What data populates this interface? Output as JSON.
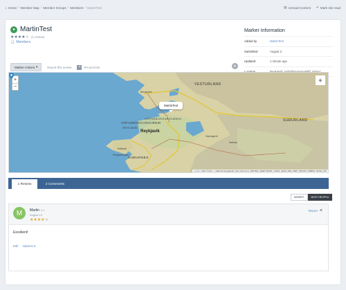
{
  "breadcrumb": {
    "items": [
      "Home",
      "Member Map",
      "Member Groups",
      "Members",
      "MartinTest"
    ]
  },
  "topnav": {
    "unread": "Unread Content",
    "mark_read": "Mark site read"
  },
  "marker": {
    "title": "MartinTest",
    "reviews_count": "(1 review)",
    "members_link": "Members",
    "rating": 4,
    "actions_btn": "Marker Actions",
    "report": "Report this review",
    "promote": "Re-promote"
  },
  "info": {
    "heading": "Marker Information",
    "rows": [
      {
        "key": "Added by",
        "value": "MartinTest"
      },
      {
        "key": "Submitted",
        "value": "August 2"
      },
      {
        "key": "Updated",
        "value": "1 minute ago"
      },
      {
        "key": "Location",
        "value": "Reykjavík, Höfuðborgarsvæðið, Island"
      },
      {
        "key": "Coordinates",
        "value": "N 64° 14' 39.756\"   W 21° 46' 4.535\""
      }
    ]
  },
  "map": {
    "zoom_in": "+",
    "zoom_out": "−",
    "popup": "MartinTest",
    "labels": {
      "vesturland": "VESTURLAND",
      "borgarnes": "Borgarnes",
      "sudurland": "SUÐURLAND",
      "hofud": "HÖFUÐBORGARSVÆÐIÐ",
      "capital": "HÖFUÐBORGARSVÆÐIN",
      "reykjavik_caps": "REYKJAVÍK",
      "reykjavik": "Reykjavík",
      "selfoss": "Selfoss",
      "keflavik": "Keflavík",
      "sudurnes": "SUÐURNES",
      "hveragerdi": "Hveragerði",
      "reykjanesbaer": "Reykjanesbær"
    },
    "attribution_link": "Leaflet",
    "attribution": " | Tiles © Esri — National Geographic, Esri, DeLorme, NAVTEQ, UNEP-WCMC, USGS, NASA, ESA, METI, NRCAN, GEBCO, NOAA, iPC"
  },
  "tabs": {
    "reviews": "1 Review",
    "comments": "2 Comments"
  },
  "sort": {
    "newest": "NEWEST",
    "helpful": "MOST HELPFUL"
  },
  "review": {
    "avatar_letter": "M",
    "author": "Martin",
    "rep": "● 4",
    "date": "August 13",
    "rating": 4,
    "report": "Report",
    "body": "Excellent!",
    "edit": "Edit",
    "options": "Options"
  },
  "colors": {
    "tab_bar": "#3d6594",
    "link": "#5a8ac7",
    "star": "#e3a52c",
    "avatar": "#87c463",
    "water": "#6aa8cf"
  }
}
